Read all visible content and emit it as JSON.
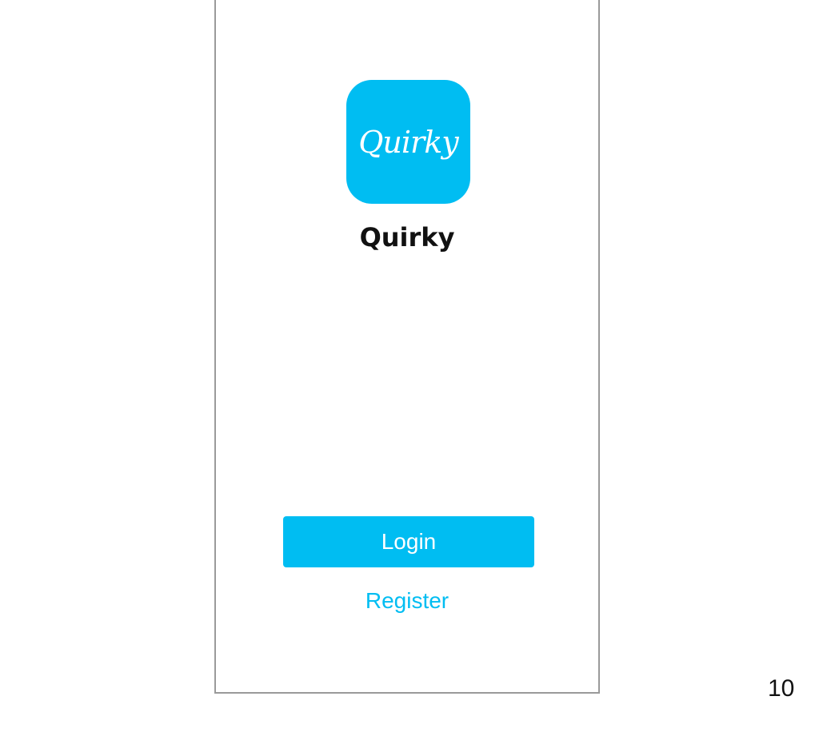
{
  "app": {
    "icon_text": "Quirky",
    "name": "Quirky"
  },
  "actions": {
    "login_label": "Login",
    "register_label": "Register"
  },
  "page_number": "10",
  "colors": {
    "brand": "#00BDF2",
    "frame_border": "#9A9A9A",
    "title_text": "#111111"
  },
  "icons": {
    "app_icon": "quirky-logo-icon"
  }
}
